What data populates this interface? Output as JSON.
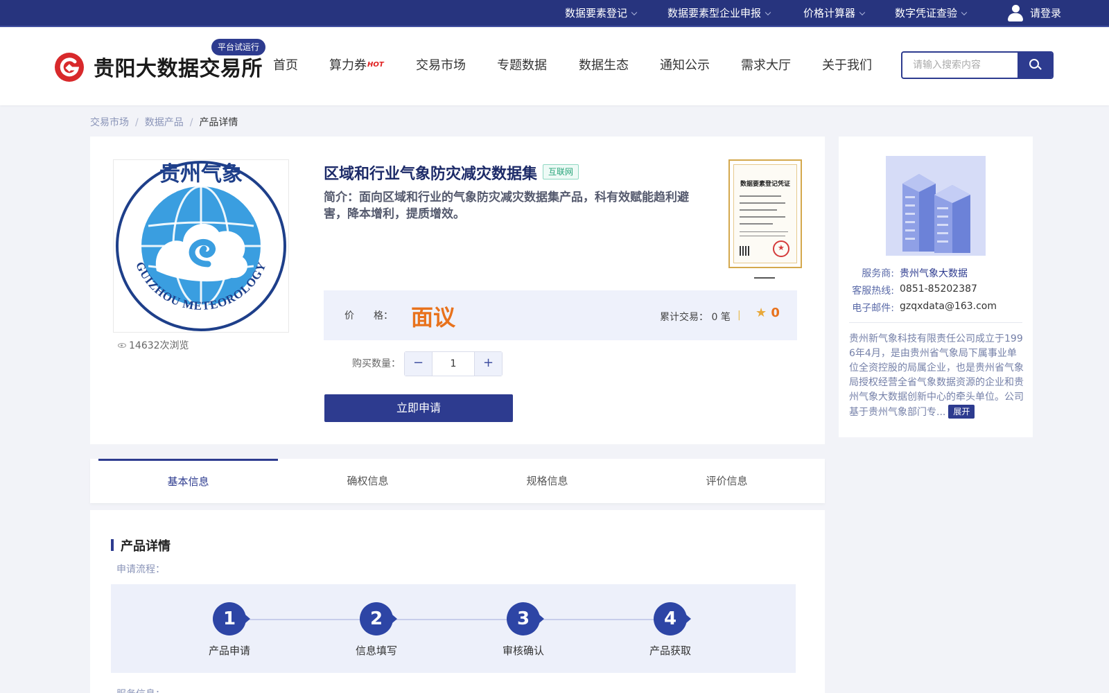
{
  "topbar": {
    "items": [
      {
        "label": "数据要素登记"
      },
      {
        "label": "数据要素型企业申报"
      },
      {
        "label": "价格计算器"
      },
      {
        "label": "数字凭证查验"
      }
    ],
    "login_label": "请登录"
  },
  "header": {
    "site_name": "贵阳大数据交易所",
    "trial_badge": "平台试运行",
    "nav": [
      {
        "label": "首页"
      },
      {
        "label": "算力券"
      },
      {
        "label": "交易市场"
      },
      {
        "label": "专题数据"
      },
      {
        "label": "数据生态"
      },
      {
        "label": "通知公示"
      },
      {
        "label": "需求大厅"
      },
      {
        "label": "关于我们"
      }
    ],
    "hot_badge": "HOT",
    "search_placeholder": "请输入搜索内容"
  },
  "breadcrumb": [
    "交易市场",
    "数据产品",
    "产品详情"
  ],
  "product": {
    "title": "区域和行业气象防灾减灾数据集",
    "tag": "互联网",
    "intro": "简介：面向区域和行业的气象防灾减灾数据集产品，科有效赋能趋利避害，降本增利，提质增效。",
    "views": "14632次浏览",
    "image_text_top": "贵州气象",
    "image_text_bottom": "GUIZHOU METEOROLOGY",
    "certificate_title": "数据要素登记凭证",
    "price_label": "价　　格：",
    "price": "面议",
    "deal_label": "累计交易：",
    "deal_count": "0",
    "deal_unit": "笔",
    "rating": "0",
    "qty_label": "购买数量：",
    "qty": "1",
    "apply_label": "立即申请"
  },
  "provider": {
    "service_key": "服务商:",
    "service_val": "贵州气象大数据",
    "hotline_key": "客服热线:",
    "hotline_val": "0851-85202387",
    "email_key": "电子邮件:",
    "email_val": "gzqxdata@163.com",
    "description": "贵州新气象科技有限责任公司成立于1996年4月，是由贵州省气象局下属事业单位全资控股的局属企业，也是贵州省气象局授权经营全省气象数据资源的企业和贵州气象大数据创新中心的牵头单位。公司基于贵州气象部门专...",
    "expand_label": "展开"
  },
  "tabs": [
    {
      "label": "基本信息",
      "active": true
    },
    {
      "label": "确权信息"
    },
    {
      "label": "规格信息"
    },
    {
      "label": "评价信息"
    }
  ],
  "details": {
    "section_title": "产品详情",
    "process_label": "申请流程：",
    "steps": [
      {
        "num": "1",
        "label": "产品申请"
      },
      {
        "num": "2",
        "label": "信息填写"
      },
      {
        "num": "3",
        "label": "审核确认"
      },
      {
        "num": "4",
        "label": "产品获取"
      }
    ],
    "service_label": "服务信息："
  },
  "colors": {
    "brand": "#2d3b8f",
    "topbar": "#27347e",
    "price": "#e8721c",
    "logo_red": "#d8292b"
  }
}
